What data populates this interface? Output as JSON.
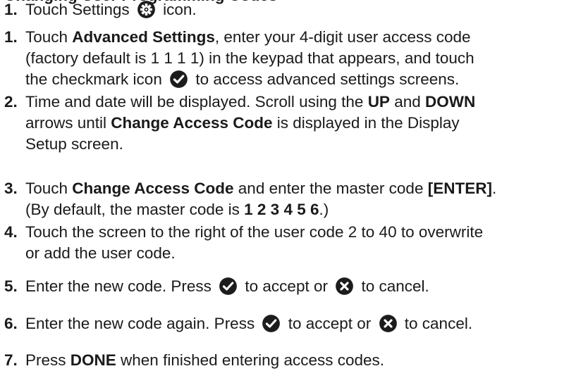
{
  "heading": "Changing User Programming Codes",
  "steps": [
    {
      "number": "1.",
      "lines": [
        [
          {
            "t": "Touch Settings "
          },
          {
            "icon": "gear"
          },
          {
            "t": " icon."
          }
        ]
      ]
    },
    {
      "number": "1.",
      "lines": [
        [
          {
            "t": "Touch "
          },
          {
            "t": "Advanced Settings",
            "b": true
          },
          {
            "t": ", enter your 4-digit user access code"
          }
        ],
        [
          {
            "t": "(factory default is 1 1 1 1) in the keypad that appears, and touch"
          }
        ],
        [
          {
            "t": "the checkmark icon "
          },
          {
            "icon": "check"
          },
          {
            "t": " to access advanced settings screens."
          }
        ]
      ]
    },
    {
      "number": "2.",
      "lines": [
        [
          {
            "t": "Time and date will be displayed. Scroll using the "
          },
          {
            "t": "UP",
            "b": true
          },
          {
            "t": " and "
          },
          {
            "t": "DOWN",
            "b": true
          }
        ],
        [
          {
            "t": "arrows until "
          },
          {
            "t": "Change Access Code",
            "b": true
          },
          {
            "t": " is displayed in the Display"
          }
        ],
        [
          {
            "t": "Setup screen."
          }
        ]
      ]
    },
    {
      "number": "3.",
      "lines": [
        [
          {
            "t": "Touch "
          },
          {
            "t": "Change Access Code",
            "b": true
          },
          {
            "t": " and enter the master code "
          },
          {
            "t": "[ENTER]",
            "b": true
          },
          {
            "t": "."
          }
        ],
        [
          {
            "t": "(By default, the master code is "
          },
          {
            "t": "1 2 3 4 5 6",
            "b": true
          },
          {
            "t": ".)"
          }
        ]
      ]
    },
    {
      "number": "4.",
      "lines": [
        [
          {
            "t": "Touch the screen to the right of the user code 2 to 40 to overwrite"
          }
        ],
        [
          {
            "t": "or add the user code."
          }
        ]
      ]
    },
    {
      "number": "5.",
      "lines": [
        [
          {
            "t": "Enter the new code. Press "
          },
          {
            "icon": "check"
          },
          {
            "t": " to accept or "
          },
          {
            "icon": "cancel"
          },
          {
            "t": " to cancel."
          }
        ]
      ]
    },
    {
      "number": "6.",
      "lines": [
        [
          {
            "t": "Enter the new code again. Press "
          },
          {
            "icon": "check"
          },
          {
            "t": " to accept or "
          },
          {
            "icon": "cancel"
          },
          {
            "t": " to cancel."
          }
        ]
      ]
    },
    {
      "number": "7.",
      "lines": [
        [
          {
            "t": "Press "
          },
          {
            "t": "DONE",
            "b": true
          },
          {
            "t": " when finished entering access codes."
          }
        ]
      ]
    }
  ]
}
